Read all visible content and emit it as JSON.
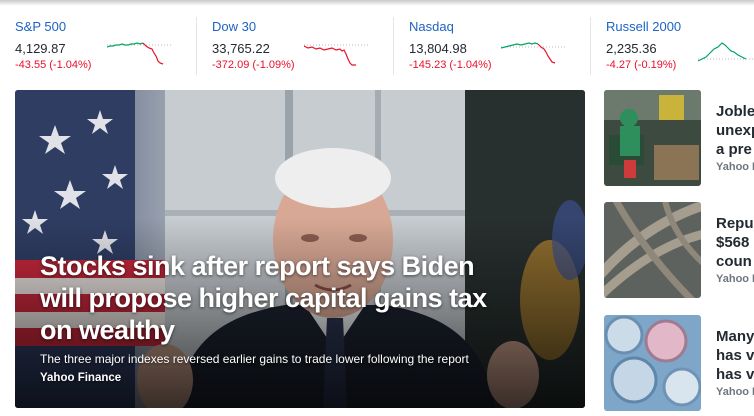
{
  "tickers": [
    {
      "name": "S&P 500",
      "value": "4,129.87",
      "change": "-43.55 (-1.04%)"
    },
    {
      "name": "Dow 30",
      "value": "33,765.22",
      "change": "-372.09 (-1.09%)"
    },
    {
      "name": "Nasdaq",
      "value": "13,804.98",
      "change": "-145.23 (-1.04%)"
    },
    {
      "name": "Russell 2000",
      "value": "2,235.36",
      "change": "-4.27 (-0.19%)"
    }
  ],
  "hero": {
    "headline": "Stocks sink after report says Biden will propose higher capital gains tax on wealthy",
    "summary": "The three major indexes reversed earlier gains to trade lower following the report",
    "source": "Yahoo Finance"
  },
  "stories": [
    {
      "title_lines": [
        "Jobless claims",
        "unexpectedly",
        "a pre"
      ],
      "source": "Yahoo Finance"
    },
    {
      "title_lines": [
        "Republicans",
        "$568",
        "coun"
      ],
      "source": "Yahoo Finance"
    },
    {
      "title_lines": [
        "Many",
        "has v",
        "has v"
      ],
      "source": "Yahoo Finance"
    }
  ],
  "colors": {
    "link": "#1d63c6",
    "negative": "#eb0f29",
    "positive": "#00a562",
    "text": "#232a31",
    "meta": "#6e7780"
  }
}
